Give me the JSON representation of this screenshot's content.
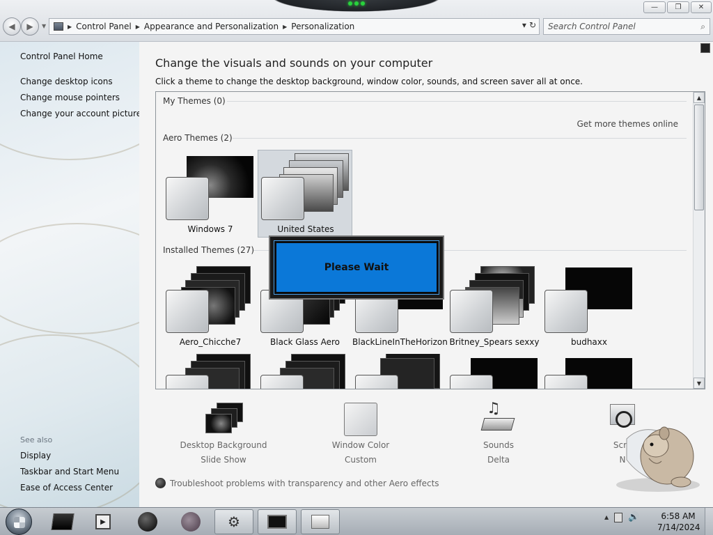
{
  "address_bar": {
    "breadcrumbs": [
      "Control Panel",
      "Appearance and Personalization",
      "Personalization"
    ],
    "search_placeholder": "Search Control Panel"
  },
  "left_pane": {
    "home": "Control Panel Home",
    "links": [
      "Change desktop icons",
      "Change mouse pointers",
      "Change your account picture"
    ],
    "see_also_label": "See also",
    "see_also_links": [
      "Display",
      "Taskbar and Start Menu",
      "Ease of Access Center"
    ]
  },
  "main": {
    "heading": "Change the visuals and sounds on your computer",
    "subheading": "Click a theme to change the desktop background, window color, sounds, and screen saver all at once.",
    "my_themes_label": "My Themes (0)",
    "get_more_link": "Get more themes online",
    "aero_themes_label": "Aero Themes (2)",
    "aero_themes": [
      "Windows 7",
      "United States"
    ],
    "selected_theme": "United States",
    "installed_themes_label": "Installed Themes (27)",
    "installed_themes": [
      "Aero_Chicche7",
      "Black Glass Aero",
      "BlackLineInTheHorizon",
      "Britney_Spears sexxy",
      "budhaxx"
    ]
  },
  "settings": {
    "desktop_background": {
      "label": "Desktop Background",
      "value": "Slide Show"
    },
    "window_color": {
      "label": "Window Color",
      "value": "Custom"
    },
    "sounds": {
      "label": "Sounds",
      "value": "Delta"
    },
    "screen_saver": {
      "label": "Scre",
      "value": "N"
    }
  },
  "troubleshoot_link": "Troubleshoot problems with transparency and other Aero effects",
  "dialog": {
    "message": "Please Wait"
  },
  "taskbar": {
    "time": "6:58 AM",
    "date": "7/14/2024"
  },
  "icons": [
    "back-arrow-icon",
    "forward-arrow-icon",
    "control-panel-icon",
    "search-icon",
    "minimize-icon",
    "maximize-icon",
    "close-icon",
    "windows-start-icon",
    "speaker-icon",
    "flag-icon"
  ]
}
